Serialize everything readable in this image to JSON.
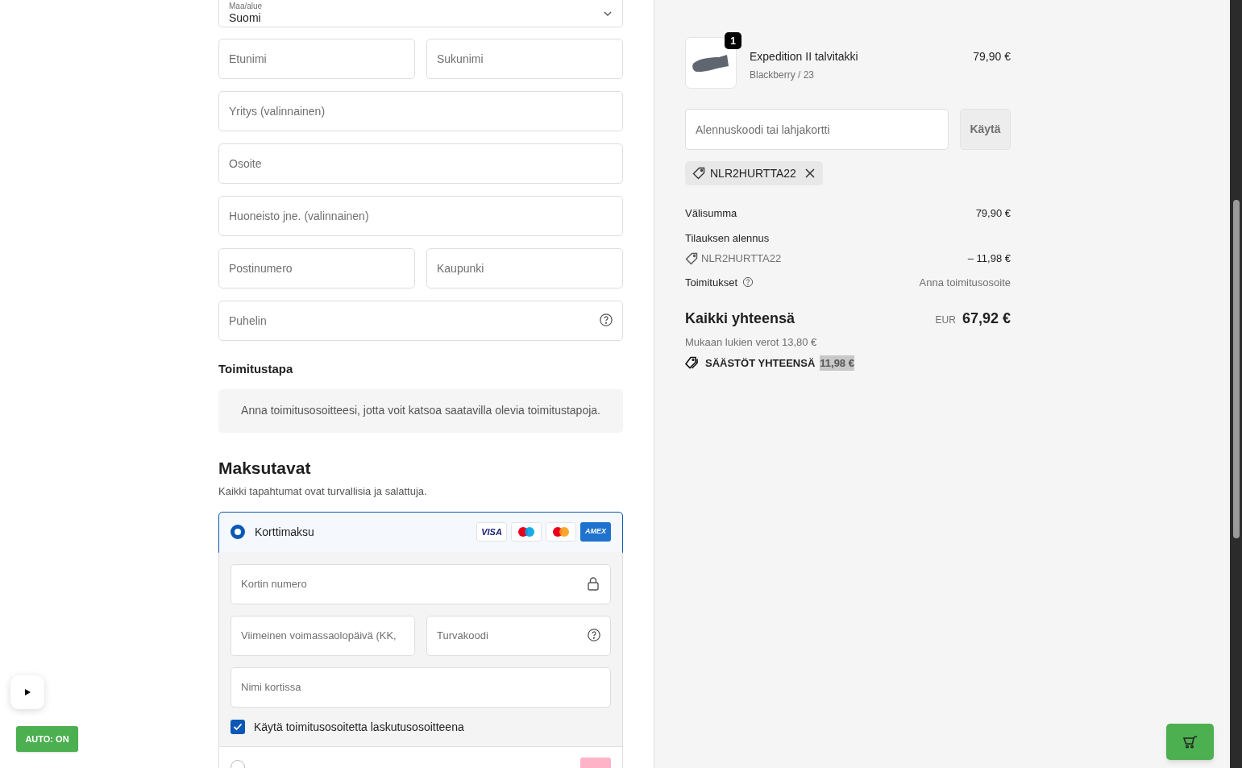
{
  "country_field": {
    "label": "Maa/alue",
    "value": "Suomi"
  },
  "address_rows": [
    {
      "fields": [
        {
          "placeholder": "Etunimi",
          "kind": "text"
        },
        {
          "placeholder": "Sukunimi",
          "kind": "text"
        }
      ]
    },
    {
      "fields": [
        {
          "placeholder": "Yritys (valinnainen)",
          "kind": "text"
        }
      ]
    },
    {
      "fields": [
        {
          "placeholder": "Osoite",
          "kind": "text"
        }
      ]
    },
    {
      "fields": [
        {
          "placeholder": "Huoneisto jne. (valinnainen)",
          "kind": "text"
        }
      ]
    },
    {
      "fields": [
        {
          "placeholder": "Postinumero",
          "kind": "text"
        },
        {
          "placeholder": "Kaupunki",
          "kind": "text"
        }
      ]
    },
    {
      "fields": [
        {
          "placeholder": "Puhelin",
          "kind": "help"
        }
      ]
    }
  ],
  "shipping": {
    "heading": "Toimitustapa",
    "notice": "Anna toimitusosoitteesi, jotta voit katsoa saatavilla olevia toimitustapoja."
  },
  "payment": {
    "heading": "Maksutavat",
    "subtitle": "Kaikki tapahtumat ovat turvallisia ja salattuja.",
    "methods": [
      {
        "label": "Korttimaksu",
        "selected": true,
        "brands": [
          {
            "kind": "visa",
            "text": "VISA"
          },
          {
            "kind": "maestro"
          },
          {
            "kind": "mastercard"
          },
          {
            "kind": "amex",
            "text": "AMEX"
          }
        ]
      },
      {
        "selected": false,
        "brands": [
          {
            "kind": "pink"
          }
        ]
      }
    ],
    "card_rows": [
      {
        "fields": [
          {
            "placeholder": "Kortin numero",
            "kind": "lock"
          }
        ]
      },
      {
        "fields": [
          {
            "placeholder": "Viimeinen voimassaolopäivä (KK,",
            "kind": "text"
          },
          {
            "placeholder": "Turvakoodi",
            "kind": "help"
          }
        ]
      },
      {
        "fields": [
          {
            "placeholder": "Nimi kortissa",
            "kind": "text"
          }
        ]
      }
    ],
    "billing": {
      "label": "Käytä toimitusosoitetta laskutusosoitteena",
      "checked": true
    }
  },
  "summary": {
    "product": {
      "name": "Expedition II talvitakki",
      "variant": "Blackberry / 23",
      "price": "79,90 €",
      "quantity": "1"
    },
    "discount": {
      "placeholder": "Alennuskoodi tai lahjakortti",
      "button": "Käytä"
    },
    "applied_code": "NLR2HURTTA22",
    "subtotal": {
      "label": "Välisumma",
      "value": "79,90 €"
    },
    "order_discount": {
      "label": "Tilauksen alennus",
      "code": "NLR2HURTTA22",
      "value": "– 11,98 €"
    },
    "shipping": {
      "label": "Toimitukset",
      "value": "Anna toimitusosoite"
    },
    "total": {
      "label": "Kaikki yhteensä",
      "currency": "EUR",
      "amount": "67,92 €",
      "tax_note": "Mukaan lukien verot 13,80 €",
      "savings_label": "SÄÄSTÖT YHTEENSÄ",
      "savings_amount": "11,98 €"
    }
  },
  "widgets": {
    "auto_button": "AUTO: ON"
  }
}
